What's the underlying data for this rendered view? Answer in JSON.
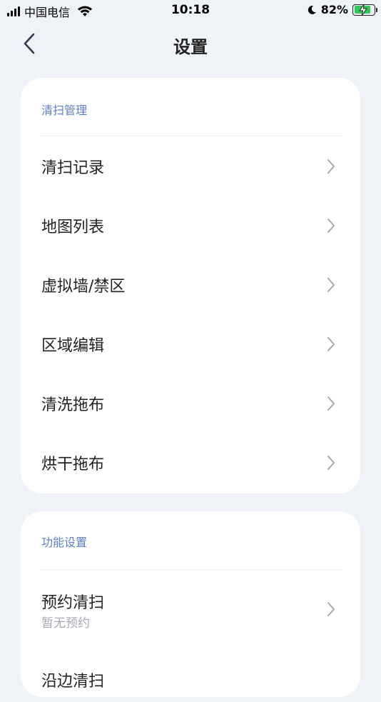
{
  "status_bar": {
    "carrier": "中国电信",
    "time": "10:18",
    "battery_percent": "82%",
    "battery_level": 0.82
  },
  "nav": {
    "title": "设置",
    "back_icon": "chevron-left-icon"
  },
  "sections": [
    {
      "title": "清扫管理",
      "items": [
        {
          "label": "清扫记录"
        },
        {
          "label": "地图列表"
        },
        {
          "label": "虚拟墙/禁区"
        },
        {
          "label": "区域编辑"
        },
        {
          "label": "清洗拖布"
        },
        {
          "label": "烘干拖布"
        }
      ]
    },
    {
      "title": "功能设置",
      "items": [
        {
          "label": "预约清扫",
          "sub": "暂无预约"
        },
        {
          "label": "沿边清扫"
        }
      ]
    }
  ],
  "colors": {
    "background": "#eff2f6",
    "section_title": "#5b7fc4",
    "battery_fill": "#34c759"
  }
}
